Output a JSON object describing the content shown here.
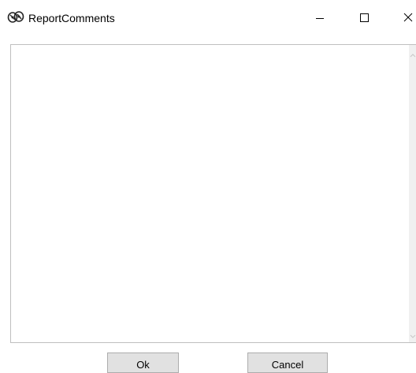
{
  "window": {
    "title": "ReportComments",
    "app_icon": "reports-icon",
    "controls": {
      "minimize_icon": "minimize-icon",
      "maximize_icon": "maximize-icon",
      "close_icon": "close-icon"
    }
  },
  "comments": {
    "value": ""
  },
  "buttons": {
    "ok_label": "Ok",
    "cancel_label": "Cancel"
  },
  "colors": {
    "button_face": "#e1e1e1",
    "button_border": "#adadad",
    "field_border": "#bfbfbf",
    "scrollbar_track": "#f0f0f0"
  }
}
